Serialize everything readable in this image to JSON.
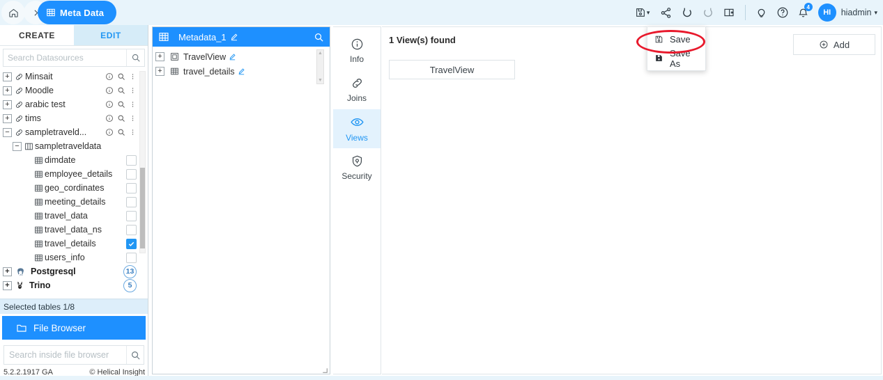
{
  "topbar": {
    "home_icon": "home-icon",
    "chevron_icon": "chevron-right-icon",
    "active_crumb": "Meta Data",
    "active_crumb_icon": "grid-table-icon",
    "tools": [
      {
        "name": "save-dropdown-icon",
        "label": "save"
      },
      {
        "name": "share-icon",
        "label": "share"
      },
      {
        "name": "undo-icon",
        "label": "undo"
      },
      {
        "name": "redo-icon",
        "label": "redo"
      },
      {
        "name": "panel-toggle-icon",
        "label": "panel"
      },
      {
        "name": "bulb-icon",
        "label": "tips"
      },
      {
        "name": "help-icon",
        "label": "help"
      },
      {
        "name": "bell-icon",
        "label": "notifications"
      }
    ],
    "notification_count": "4",
    "avatar_initials": "HI",
    "username": "hiadmin",
    "accent_blue": "#1e90ff",
    "bar_bg": "#e8f4fb"
  },
  "sidebar": {
    "tabs": [
      {
        "label": "CREATE",
        "active": false
      },
      {
        "label": "EDIT",
        "active": true
      }
    ],
    "search_placeholder": "Search Datasources",
    "datasources": [
      {
        "label": "Minsait",
        "toggle": "+",
        "icon": "link-icon",
        "indent": 0,
        "type": "datasource"
      },
      {
        "label": "Moodle",
        "toggle": "+",
        "icon": "link-icon",
        "indent": 0,
        "type": "datasource"
      },
      {
        "label": "arabic test",
        "toggle": "+",
        "icon": "link-icon",
        "indent": 0,
        "type": "datasource"
      },
      {
        "label": "tims",
        "toggle": "+",
        "icon": "link-icon",
        "indent": 0,
        "type": "datasource"
      },
      {
        "label": "sampletraveld...",
        "toggle": "−",
        "icon": "link-icon",
        "indent": 0,
        "type": "datasource"
      },
      {
        "label": "sampletraveldata",
        "toggle": "−",
        "icon": "schema-icon",
        "indent": 1,
        "type": "schema"
      },
      {
        "label": "dimdate",
        "icon": "table-icon",
        "indent": 2,
        "type": "table",
        "checked": false
      },
      {
        "label": "employee_details",
        "icon": "table-icon",
        "indent": 2,
        "type": "table",
        "checked": false
      },
      {
        "label": "geo_cordinates",
        "icon": "table-icon",
        "indent": 2,
        "type": "table",
        "checked": false
      },
      {
        "label": "meeting_details",
        "icon": "table-icon",
        "indent": 2,
        "type": "table",
        "checked": false
      },
      {
        "label": "travel_data",
        "icon": "table-icon",
        "indent": 2,
        "type": "table",
        "checked": false
      },
      {
        "label": "travel_data_ns",
        "icon": "table-icon",
        "indent": 2,
        "type": "table",
        "checked": false
      },
      {
        "label": "travel_details",
        "icon": "table-icon",
        "indent": 2,
        "type": "table",
        "checked": true
      },
      {
        "label": "users_info",
        "icon": "table-icon",
        "indent": 2,
        "type": "table",
        "checked": false
      }
    ],
    "db_groups": [
      {
        "label": "Postgresql",
        "toggle": "+",
        "icon": "postgresql-elephant-icon",
        "count": "13"
      },
      {
        "label": "Trino",
        "toggle": "+",
        "icon": "trino-rabbit-icon",
        "count": "5"
      }
    ],
    "row_action_icons": [
      "info-icon",
      "search-icon",
      "kebab-menu-icon"
    ],
    "status": "Selected tables 1/8",
    "file_browser": {
      "label": "File Browser",
      "icon": "folder-icon",
      "search_placeholder": "Search inside file browser"
    },
    "footer": {
      "version": "5.2.2.1917 GA",
      "copyright": "© Helical Insight"
    }
  },
  "meta_panel": {
    "title": "Metadata_1",
    "title_icon": "grid-table-icon",
    "edit_icon": "pencil-icon",
    "search_icon": "search-icon",
    "items": [
      {
        "label": "TravelView",
        "toggle": "+",
        "icon": "view-icon",
        "edit_icon": "pencil-icon"
      },
      {
        "label": "travel_details",
        "toggle": "+",
        "icon": "table-icon",
        "edit_icon": "pencil-icon"
      }
    ]
  },
  "vtabs": [
    {
      "label": "Info",
      "icon": "info-icon",
      "active": false
    },
    {
      "label": "Joins",
      "icon": "link-icon",
      "active": false
    },
    {
      "label": "Views",
      "icon": "eye-icon",
      "active": true
    },
    {
      "label": "Security",
      "icon": "shield-lock-icon",
      "active": false
    }
  ],
  "content": {
    "found_text": "1 View(s) found",
    "view_cards": [
      "TravelView"
    ],
    "add_button": {
      "label": "Add",
      "icon": "plus-circle-icon"
    }
  },
  "save_menu": {
    "items": [
      {
        "label": "Save",
        "icon": "save-outline-icon",
        "highlighted": true
      },
      {
        "label": "Save As",
        "icon": "save-filled-icon",
        "highlighted": false
      }
    ],
    "highlight_color": "#e8192c"
  }
}
